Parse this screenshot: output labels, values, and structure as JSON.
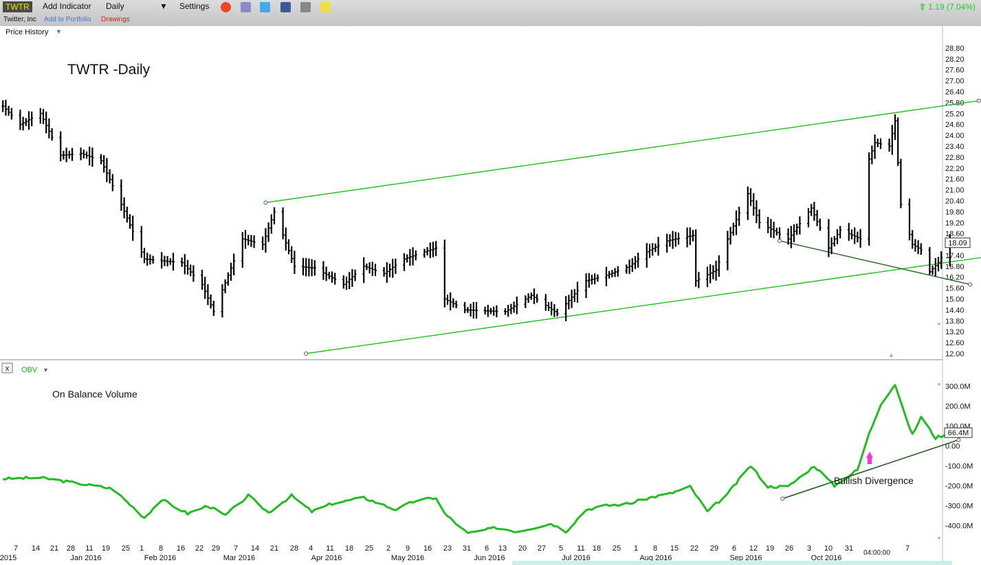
{
  "toolbar": {
    "ticker": "TWTR",
    "add_indicator": "Add Indicator",
    "interval": "Daily",
    "settings": "Settings",
    "company": "Twitter, Inc",
    "add_to_portfolio": "Add to Portfolio",
    "drawings": "Drawings",
    "change": "1.19 (7.04%)",
    "icons": [
      "alarm-clock-icon",
      "book-icon",
      "twitter-icon",
      "facebook-icon",
      "camera-icon",
      "note-icon"
    ]
  },
  "price_panel": {
    "label": "Price History",
    "chart_title": "TWTR -Daily",
    "last_price": "18.09"
  },
  "obv_panel": {
    "indicator": "OBV",
    "close_label": "x",
    "title": "On Balance Volume",
    "last_value": "66.4M",
    "annotation": "Bullish Divergence"
  },
  "x_axis": {
    "day_ticks": [
      "7",
      "14",
      "21",
      "28",
      "11",
      "19",
      "25",
      "1",
      "8",
      "16",
      "22",
      "29",
      "7",
      "14",
      "21",
      "28",
      "4",
      "11",
      "18",
      "25",
      "2",
      "9",
      "16",
      "23",
      "31",
      "6",
      "13",
      "20",
      "27",
      "5",
      "11",
      "18",
      "25",
      "1",
      "8",
      "15",
      "22",
      "29",
      "6",
      "12",
      "19",
      "26",
      "3",
      "10",
      "31",
      "7"
    ],
    "month_labels": [
      "2015",
      "Jan 2016",
      "Feb 2016",
      "Mar 2016",
      "Apr 2016",
      "May 2016",
      "Jun 2016",
      "Jul 2016",
      "Aug 2016",
      "Sep 2016",
      "Oct 2016"
    ],
    "time_label": "04:00:00"
  },
  "chart_data": [
    {
      "type": "ohlc",
      "name": "TWTR",
      "ylim": [
        12.0,
        29.1
      ],
      "yticks": [
        28.8,
        28.2,
        27.6,
        27.0,
        26.4,
        25.8,
        25.2,
        24.6,
        24.0,
        23.4,
        22.8,
        22.2,
        21.6,
        21.0,
        20.4,
        19.8,
        19.2,
        18.6,
        18.0,
        17.4,
        16.8,
        16.2,
        15.6,
        15.0,
        14.4,
        13.8,
        13.2,
        12.6,
        12.0
      ],
      "keypoints": [
        {
          "date": "2015-12-01",
          "close": 25.6
        },
        {
          "date": "2015-12-07",
          "close": 24.6
        },
        {
          "date": "2015-12-14",
          "close": 25.2
        },
        {
          "date": "2015-12-21",
          "close": 22.9
        },
        {
          "date": "2015-12-28",
          "close": 23.0
        },
        {
          "date": "2016-01-04",
          "close": 22.6
        },
        {
          "date": "2016-01-11",
          "close": 20.2
        },
        {
          "date": "2016-01-19",
          "close": 17.2
        },
        {
          "date": "2016-01-25",
          "close": 17.1
        },
        {
          "date": "2016-02-01",
          "close": 17.0
        },
        {
          "date": "2016-02-08",
          "close": 15.8
        },
        {
          "date": "2016-02-12",
          "close": 14.3
        },
        {
          "date": "2016-02-16",
          "close": 15.9
        },
        {
          "date": "2016-02-22",
          "close": 18.3
        },
        {
          "date": "2016-02-29",
          "close": 18.0
        },
        {
          "date": "2016-03-04",
          "close": 19.8
        },
        {
          "date": "2016-03-11",
          "close": 16.8
        },
        {
          "date": "2016-03-18",
          "close": 16.7
        },
        {
          "date": "2016-03-28",
          "close": 15.8
        },
        {
          "date": "2016-04-04",
          "close": 16.8
        },
        {
          "date": "2016-04-11",
          "close": 16.4
        },
        {
          "date": "2016-04-18",
          "close": 17.2
        },
        {
          "date": "2016-04-25",
          "close": 17.6
        },
        {
          "date": "2016-04-29",
          "close": 17.8
        },
        {
          "date": "2016-05-02",
          "close": 15.0
        },
        {
          "date": "2016-05-09",
          "close": 14.4
        },
        {
          "date": "2016-05-23",
          "close": 14.3
        },
        {
          "date": "2016-06-01",
          "close": 15.2
        },
        {
          "date": "2016-06-10",
          "close": 14.2
        },
        {
          "date": "2016-06-20",
          "close": 16.0
        },
        {
          "date": "2016-06-27",
          "close": 16.3
        },
        {
          "date": "2016-07-05",
          "close": 16.8
        },
        {
          "date": "2016-07-11",
          "close": 17.6
        },
        {
          "date": "2016-07-18",
          "close": 18.2
        },
        {
          "date": "2016-07-27",
          "close": 18.5
        },
        {
          "date": "2016-07-28",
          "close": 16.0
        },
        {
          "date": "2016-08-04",
          "close": 16.6
        },
        {
          "date": "2016-08-08",
          "close": 18.3
        },
        {
          "date": "2016-08-15",
          "close": 20.8
        },
        {
          "date": "2016-08-19",
          "close": 19.2
        },
        {
          "date": "2016-08-29",
          "close": 18.3
        },
        {
          "date": "2016-09-06",
          "close": 20.0
        },
        {
          "date": "2016-09-12",
          "close": 17.8
        },
        {
          "date": "2016-09-16",
          "close": 18.8
        },
        {
          "date": "2016-09-23",
          "close": 18.3
        },
        {
          "date": "2016-09-26",
          "close": 22.7
        },
        {
          "date": "2016-09-28",
          "close": 23.6
        },
        {
          "date": "2016-10-03",
          "close": 23.4
        },
        {
          "date": "2016-10-05",
          "close": 24.8
        },
        {
          "date": "2016-10-07",
          "close": 20.2
        },
        {
          "date": "2016-10-11",
          "close": 18.0
        },
        {
          "date": "2016-10-14",
          "close": 17.7
        },
        {
          "date": "2016-10-17",
          "close": 16.5
        },
        {
          "date": "2016-10-20",
          "close": 17.0
        },
        {
          "date": "2016-10-24",
          "close": 18.09
        }
      ],
      "trendlines": [
        {
          "from": {
            "date": "2016-03-01",
            "price": 20.3
          },
          "to": {
            "date": "2016-11-03",
            "price": 25.9
          },
          "color": "#22bb22"
        },
        {
          "from": {
            "date": "2016-03-15",
            "price": 12.0
          },
          "to": {
            "date": "2016-11-18",
            "price": 17.6
          },
          "color": "#22bb22"
        },
        {
          "from": {
            "date": "2016-08-26",
            "price": 18.2
          },
          "to": {
            "date": "2016-10-31",
            "price": 15.8
          },
          "color": "#1e5f1e"
        }
      ]
    },
    {
      "type": "line",
      "name": "OBV",
      "ylim": [
        -450,
        350
      ],
      "yticks": [
        300,
        200,
        100,
        0,
        -100,
        -200,
        -300,
        -400
      ],
      "ytick_labels": [
        "300.0M",
        "200.0M",
        "100.0M",
        "0.00",
        "-100.0M",
        "-200.0M",
        "-300.0M",
        "-400.0M"
      ],
      "keypoints": [
        {
          "date": "2015-12-01",
          "value": -165
        },
        {
          "date": "2015-12-14",
          "value": -160
        },
        {
          "date": "2015-12-28",
          "value": -190
        },
        {
          "date": "2016-01-08",
          "value": -215
        },
        {
          "date": "2016-01-19",
          "value": -360
        },
        {
          "date": "2016-01-25",
          "value": -270
        },
        {
          "date": "2016-02-03",
          "value": -340
        },
        {
          "date": "2016-02-10",
          "value": -300
        },
        {
          "date": "2016-02-16",
          "value": -350
        },
        {
          "date": "2016-02-24",
          "value": -250
        },
        {
          "date": "2016-03-02",
          "value": -335
        },
        {
          "date": "2016-03-10",
          "value": -250
        },
        {
          "date": "2016-03-17",
          "value": -330
        },
        {
          "date": "2016-03-24",
          "value": -290
        },
        {
          "date": "2016-04-04",
          "value": -260
        },
        {
          "date": "2016-04-15",
          "value": -320
        },
        {
          "date": "2016-04-22",
          "value": -275
        },
        {
          "date": "2016-04-29",
          "value": -260
        },
        {
          "date": "2016-05-02",
          "value": -340
        },
        {
          "date": "2016-05-10",
          "value": -440
        },
        {
          "date": "2016-05-20",
          "value": -410
        },
        {
          "date": "2016-05-27",
          "value": -430
        },
        {
          "date": "2016-06-08",
          "value": -390
        },
        {
          "date": "2016-06-13",
          "value": -430
        },
        {
          "date": "2016-06-20",
          "value": -320
        },
        {
          "date": "2016-06-27",
          "value": -300
        },
        {
          "date": "2016-07-05",
          "value": -290
        },
        {
          "date": "2016-07-12",
          "value": -260
        },
        {
          "date": "2016-07-19",
          "value": -240
        },
        {
          "date": "2016-07-26",
          "value": -205
        },
        {
          "date": "2016-08-01",
          "value": -330
        },
        {
          "date": "2016-08-08",
          "value": -240
        },
        {
          "date": "2016-08-16",
          "value": -100
        },
        {
          "date": "2016-08-22",
          "value": -205
        },
        {
          "date": "2016-08-29",
          "value": -205
        },
        {
          "date": "2016-09-07",
          "value": -100
        },
        {
          "date": "2016-09-14",
          "value": -200
        },
        {
          "date": "2016-09-22",
          "value": -120
        },
        {
          "date": "2016-09-26",
          "value": 60
        },
        {
          "date": "2016-09-30",
          "value": 210
        },
        {
          "date": "2016-10-05",
          "value": 310
        },
        {
          "date": "2016-10-07",
          "value": 215
        },
        {
          "date": "2016-10-11",
          "value": 55
        },
        {
          "date": "2016-10-14",
          "value": 145
        },
        {
          "date": "2016-10-19",
          "value": 40
        },
        {
          "date": "2016-10-24",
          "value": 66.4
        }
      ],
      "trendlines": [
        {
          "from": {
            "date": "2016-08-27",
            "value": -265
          },
          "to": {
            "date": "2016-10-27",
            "value": 30
          },
          "color": "#1e5f1e"
        }
      ]
    }
  ],
  "colors": {
    "price_bar": "#000000",
    "obv_line": "#22bb22",
    "trend_green": "#22bb22",
    "trend_dark": "#1e5f1e",
    "arrow": "#ff33dd",
    "change_up": "#22cc22"
  }
}
